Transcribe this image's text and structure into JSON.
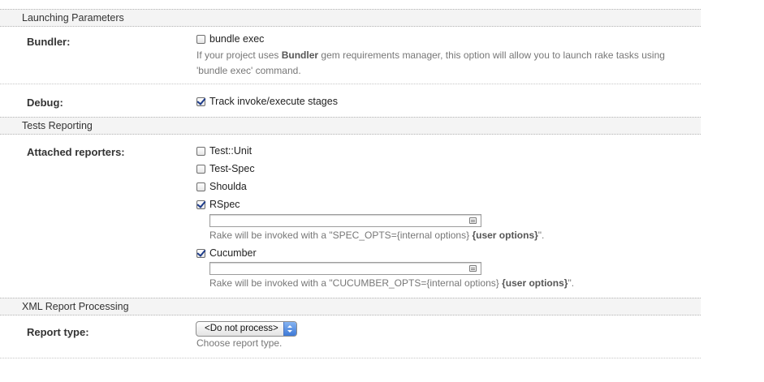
{
  "sections": {
    "launching": "Launching Parameters",
    "tests": "Tests Reporting",
    "xml": "XML Report Processing"
  },
  "bundler": {
    "label": "Bundler:",
    "option": "bundle exec",
    "checked": false,
    "help_prefix": "If your project uses ",
    "help_bold": "Bundler",
    "help_suffix": " gem requirements manager, this option will allow you to launch rake tasks using",
    "help_line2": "'bundle exec' command."
  },
  "debug": {
    "label": "Debug:",
    "option": "Track invoke/execute stages",
    "checked": true
  },
  "reporters": {
    "label": "Attached reporters:",
    "items": [
      {
        "label": "Test::Unit",
        "checked": false
      },
      {
        "label": "Test-Spec",
        "checked": false
      },
      {
        "label": "Shoulda",
        "checked": false
      },
      {
        "label": "RSpec",
        "checked": true
      },
      {
        "label": "Cucumber",
        "checked": true
      }
    ],
    "rspec_value": "",
    "rspec_note_prefix": "Rake will be invoked with a \"SPEC_OPTS={internal options} ",
    "rspec_note_bold": "{user options}",
    "rspec_note_suffix": "\".",
    "cucumber_value": "",
    "cucumber_note_prefix": "Rake will be invoked with a \"CUCUMBER_OPTS={internal options} ",
    "cucumber_note_bold": "{user options}",
    "cucumber_note_suffix": "\"."
  },
  "report_type": {
    "label": "Report type:",
    "selected": "<Do not process>",
    "help": "Choose report type."
  }
}
